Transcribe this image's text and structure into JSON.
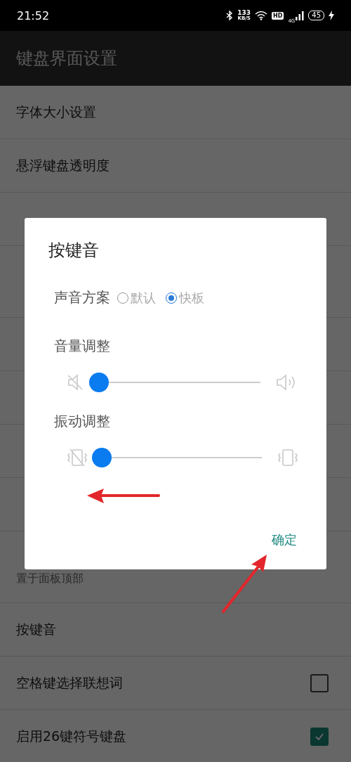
{
  "status_bar": {
    "time": "21:52",
    "net_speed": "133",
    "net_unit": "KB/S",
    "hd": "HD",
    "network": "4G",
    "battery": "45"
  },
  "app_bar": {
    "title": "键盘界面设置"
  },
  "settings": [
    {
      "kind": "plain",
      "title": "字体大小设置"
    },
    {
      "kind": "plain",
      "title": "悬浮键盘透明度"
    },
    {
      "kind": "covered"
    },
    {
      "kind": "covered_tall"
    },
    {
      "kind": "covered"
    },
    {
      "kind": "covered"
    },
    {
      "kind": "covered"
    },
    {
      "kind": "covered"
    },
    {
      "kind": "covered",
      "subtitle": "置于面板顶部"
    },
    {
      "kind": "plain",
      "title": "按键音"
    },
    {
      "kind": "checkbox",
      "title": "空格键选择联想词",
      "checked": false
    },
    {
      "kind": "checkbox",
      "title": "启用26键符号键盘",
      "checked": true
    }
  ],
  "dialog": {
    "title": "按键音",
    "scheme_label": "声音方案",
    "scheme_options": [
      {
        "label": "默认",
        "selected": false
      },
      {
        "label": "快板",
        "selected": true
      }
    ],
    "sliders": [
      {
        "kind": "volume",
        "label": "音量调整",
        "level": 0
      },
      {
        "kind": "vibration",
        "label": "振动调整",
        "level": 0
      }
    ],
    "confirm": "确定"
  }
}
